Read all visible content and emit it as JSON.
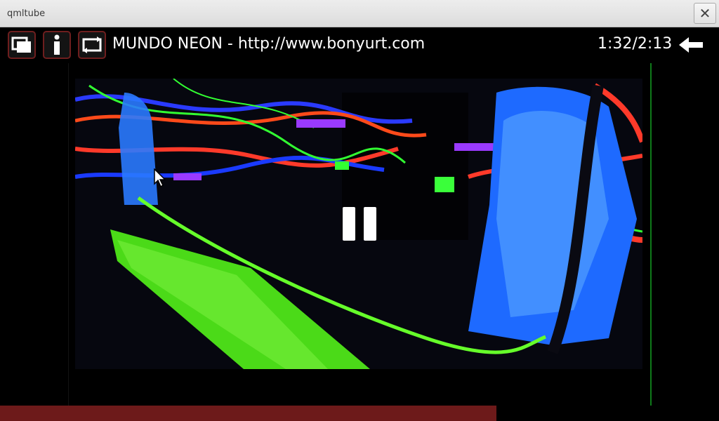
{
  "window": {
    "title": "qmltube"
  },
  "toolbar": {
    "buttons": [
      {
        "icon": "windows-icon"
      },
      {
        "icon": "info-icon"
      },
      {
        "icon": "repeat-icon"
      }
    ],
    "video_title": "MUNDO NEON - http://www.bonyurt.com",
    "time": "1:32/2:13",
    "back_icon": "left-arrow-icon"
  },
  "player": {
    "state_icon": "pause-icon",
    "progress_fraction": 0.69
  },
  "colors": {
    "button_border": "#6e1e1e",
    "progress_fill": "#6d1a1a",
    "side_line": "#0f7a1a"
  }
}
